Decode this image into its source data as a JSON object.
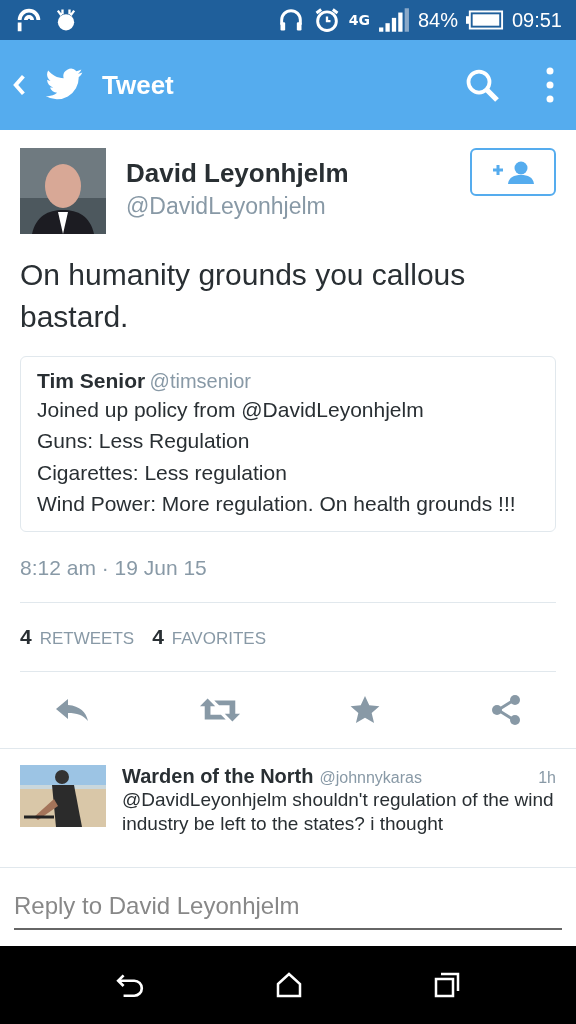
{
  "status_bar": {
    "network": "4G",
    "battery": "84%",
    "time": "09:51"
  },
  "header": {
    "title": "Tweet"
  },
  "tweet": {
    "author": "David Leyonhjelm",
    "handle": "@DavidLeyonhjelm",
    "text": "On humanity grounds you callous bastard.",
    "quoted": {
      "author": "Tim Senior",
      "handle": "@timsenior",
      "lines": [
        "Joined up policy from @DavidLeyonhjelm",
        "Guns: Less Regulation",
        "Cigarettes: Less regulation",
        "Wind Power: More regulation. On health grounds !!!"
      ]
    },
    "timestamp": "8:12 am · 19 Jun 15",
    "stats": [
      {
        "count": "4",
        "label": "RETWEETS"
      },
      {
        "count": "4",
        "label": "FAVORITES"
      }
    ]
  },
  "reply": {
    "author": "Warden of the North",
    "handle": "@johnnykaras",
    "time": "1h",
    "text": "@DavidLeyonhjelm shouldn't regulation of the wind industry be left to the states? i thought"
  },
  "reply_field": {
    "placeholder": "Reply to David Leyonhjelm"
  }
}
